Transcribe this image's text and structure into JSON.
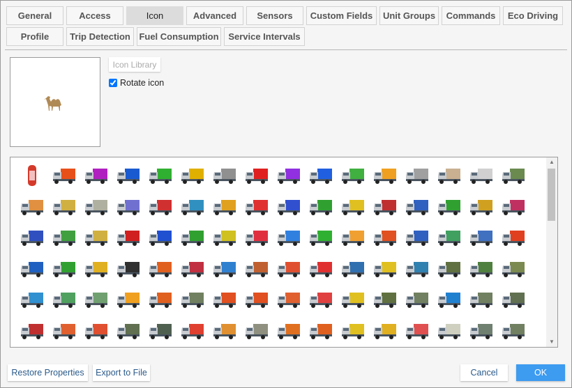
{
  "tabs_row1": [
    "General",
    "Access",
    "Icon",
    "Advanced",
    "Sensors",
    "Custom Fields",
    "Unit Groups",
    "Commands",
    "Eco Driving"
  ],
  "tabs_row2": [
    "Profile",
    "Trip Detection",
    "Fuel Consumption",
    "Service Intervals"
  ],
  "active_tab": "Icon",
  "icon_library_label": "Icon Library",
  "rotate_icon_label": "Rotate icon",
  "rotate_icon_checked": true,
  "current_icon": "camel-icon",
  "icon_colors": [
    [
      "#d43a2a",
      "#e8501a",
      "#b020c0",
      "#1a5ad0",
      "#30b030",
      "#e0b000",
      "#909090",
      "#e02020",
      "#9030e0",
      "#2060e0",
      "#40b040",
      "#f0a020",
      "#a0a0a0",
      "#c8b090",
      "#d0d0d0",
      "#6a8a50"
    ],
    [
      "#e09040",
      "#d0b040",
      "#b0b0a0",
      "#7070d0",
      "#d03030",
      "#3090c0",
      "#e0a020",
      "#e03030",
      "#3050d0",
      "#30a030",
      "#e0c020",
      "#c03030",
      "#3060c0",
      "#30a030",
      "#d0a020",
      "#c03060"
    ],
    [
      "#3050c0",
      "#40a040",
      "#d0b040",
      "#d02020",
      "#2050d0",
      "#30a030",
      "#d0c020",
      "#e03040",
      "#3080e0",
      "#30b030",
      "#f0a030",
      "#e05020",
      "#3060c0",
      "#40a060",
      "#4070c0",
      "#e04020"
    ],
    [
      "#2060c0",
      "#30a030",
      "#e0b020",
      "#303030",
      "#e06020",
      "#c03040",
      "#3080d0",
      "#c06030",
      "#e05030",
      "#e03030",
      "#3070b0",
      "#e0c020",
      "#3080b0",
      "#607040",
      "#508040",
      "#7a8a50"
    ],
    [
      "#3090d0",
      "#50a060",
      "#70a070",
      "#f0a020",
      "#e06020",
      "#708060",
      "#e05020",
      "#e05020",
      "#e06030",
      "#e04040",
      "#e0c020",
      "#607040",
      "#708060",
      "#2080d0",
      "#708060",
      "#607050"
    ],
    [
      "#c03030",
      "#e06030",
      "#e05030",
      "#607050",
      "#506050",
      "#e04030",
      "#e09030",
      "#909080",
      "#e07020",
      "#e06020",
      "#e0c020",
      "#e0b020",
      "#e05050",
      "#d0d0c0",
      "#708070",
      "#708060"
    ]
  ],
  "footer": {
    "restore": "Restore Properties",
    "export": "Export to File",
    "cancel": "Cancel",
    "ok": "OK"
  }
}
